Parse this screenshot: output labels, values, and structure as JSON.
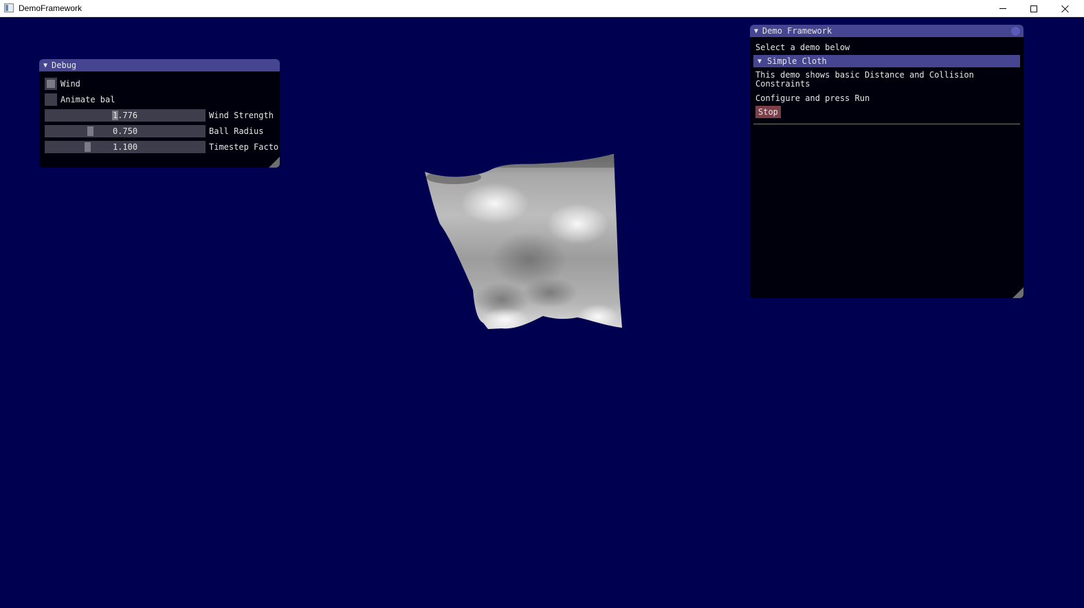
{
  "window": {
    "title": "DemoFramework"
  },
  "debug_panel": {
    "title": "Debug",
    "checkboxes": [
      {
        "label": "Wind",
        "checked": false
      },
      {
        "label": "Animate bal",
        "checked": false
      }
    ],
    "sliders": [
      {
        "value": "1.776",
        "label": "Wind Strength",
        "fraction": 0.44
      },
      {
        "value": "0.750",
        "label": "Ball Radius",
        "fraction": 0.28
      },
      {
        "value": "1.100",
        "label": "Timestep Factor",
        "fraction": 0.26
      }
    ]
  },
  "demo_panel": {
    "title": "Demo Framework",
    "intro": "Select a demo below",
    "section_title": "Simple Cloth",
    "description_line1": "This demo shows basic Distance and Collision",
    "description_line2": "Constraints",
    "instruction": "Configure and press Run",
    "stop_label": "Stop"
  },
  "colors": {
    "background": "#000050",
    "header": "#454592",
    "stop_button": "#7f3f4a"
  }
}
